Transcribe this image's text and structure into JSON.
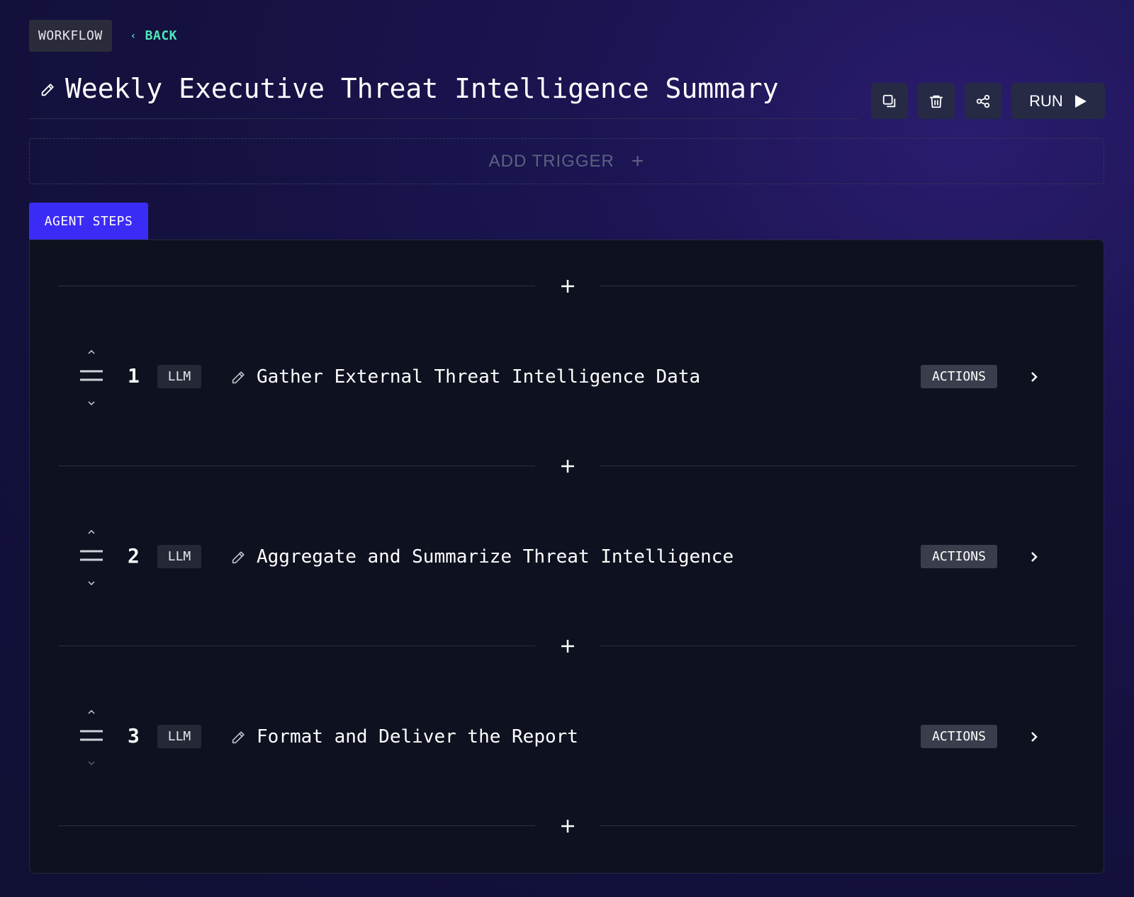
{
  "header": {
    "workflow_tag": "WORKFLOW",
    "back_label": "BACK",
    "title": "Weekly Executive Threat Intelligence Summary",
    "run_label": "RUN"
  },
  "toolbar_icons": [
    "duplicate-icon",
    "trash-icon",
    "share-icon",
    "play-icon"
  ],
  "trigger": {
    "label": "ADD TRIGGER"
  },
  "tabs": {
    "agent_steps": "AGENT STEPS"
  },
  "steps": [
    {
      "number": "1",
      "type": "LLM",
      "title": "Gather External Threat Intelligence Data",
      "actions_label": "ACTIONS"
    },
    {
      "number": "2",
      "type": "LLM",
      "title": "Aggregate and Summarize Threat Intelligence",
      "actions_label": "ACTIONS"
    },
    {
      "number": "3",
      "type": "LLM",
      "title": "Format and Deliver the Report",
      "actions_label": "ACTIONS"
    }
  ],
  "colors": {
    "accent": "#3b2cf5",
    "back_link": "#4de8b8",
    "panel_bg": "#0e111f",
    "page_bg": "#14113f"
  }
}
